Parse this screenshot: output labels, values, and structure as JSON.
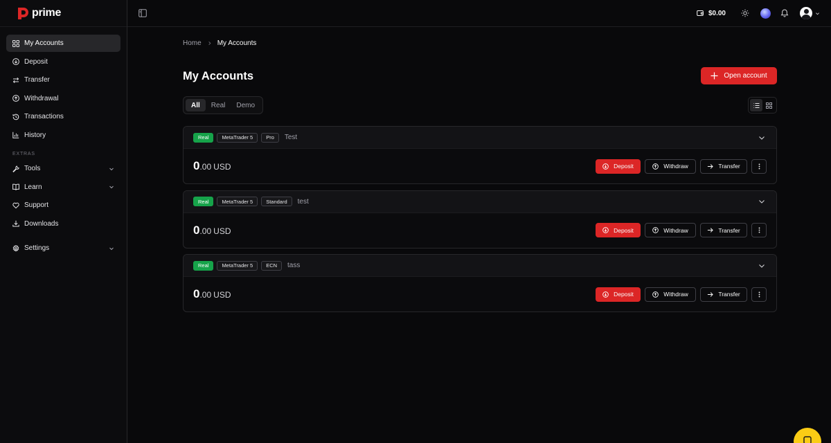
{
  "app": {
    "logo_text": "prime",
    "brand_color": "#dc2626"
  },
  "sidebar": {
    "items": [
      {
        "label": "My Accounts",
        "icon": "grid-icon",
        "active": true
      },
      {
        "label": "Deposit",
        "icon": "arrow-down-circle-icon"
      },
      {
        "label": "Transfer",
        "icon": "arrows-swap-icon"
      },
      {
        "label": "Withdrawal",
        "icon": "arrow-up-circle-icon"
      },
      {
        "label": "Transactions",
        "icon": "history-icon"
      },
      {
        "label": "History",
        "icon": "bar-chart-icon"
      }
    ],
    "section_label": "EXTRAS",
    "extras": [
      {
        "label": "Tools",
        "icon": "wrench-icon",
        "expandable": true
      },
      {
        "label": "Learn",
        "icon": "book-icon",
        "expandable": true
      },
      {
        "label": "Support",
        "icon": "heart-icon"
      },
      {
        "label": "Downloads",
        "icon": "download-icon"
      }
    ],
    "settings": {
      "label": "Settings",
      "icon": "gear-icon",
      "expandable": true
    }
  },
  "header": {
    "balance": "$0.00"
  },
  "breadcrumb": {
    "home": "Home",
    "current": "My Accounts"
  },
  "page": {
    "title": "My Accounts",
    "open_account_label": "Open account"
  },
  "filters": {
    "tabs": [
      "All",
      "Real",
      "Demo"
    ],
    "selected": "All"
  },
  "accounts": [
    {
      "type": "Real",
      "platform": "MetaTrader 5",
      "tier": "Pro",
      "name": "Test",
      "amount_int": "0",
      "amount_dec": ".00",
      "currency": "USD"
    },
    {
      "type": "Real",
      "platform": "MetaTrader 5",
      "tier": "Standard",
      "name": "test",
      "amount_int": "0",
      "amount_dec": ".00",
      "currency": "USD"
    },
    {
      "type": "Real",
      "platform": "MetaTrader 5",
      "tier": "ECN",
      "name": "tass",
      "amount_int": "0",
      "amount_dec": ".00",
      "currency": "USD"
    }
  ],
  "actions": {
    "deposit": "Deposit",
    "withdraw": "Withdraw",
    "transfer": "Transfer"
  }
}
